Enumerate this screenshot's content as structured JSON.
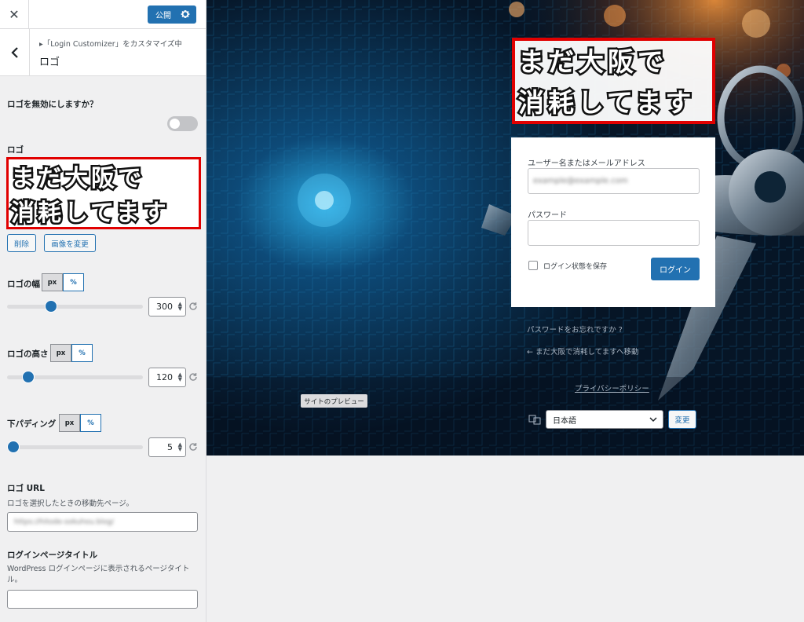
{
  "header": {
    "close_icon": "close-icon",
    "publish_label": "公開",
    "gear_icon": "gear-icon",
    "breadcrumb": "▸「Login Customizer」をカスタマイズ中",
    "section_title": "ロゴ"
  },
  "controls": {
    "disable_logo_label": "ロゴを無効にしますか？",
    "logo_label": "ロゴ",
    "logo_image_lines": [
      "まだ大阪で",
      "消耗してます"
    ],
    "remove_button": "削除",
    "change_image_button": "画像を変更",
    "logo_width": {
      "label": "ロゴの幅",
      "units": [
        "px",
        "%"
      ],
      "value": "300",
      "level": 0.3
    },
    "logo_height": {
      "label": "ロゴの高さ",
      "units": [
        "px",
        "%"
      ],
      "value": "120",
      "level": 0.15
    },
    "bottom_padding": {
      "label": "下パディング",
      "units": [
        "px",
        "%"
      ],
      "value": "5",
      "level": 0.02
    },
    "logo_url": {
      "label": "ロゴ URL",
      "description": "ロゴを選択したときの移動先ページ。",
      "value": "https://hitode-sokuhou.blog/"
    },
    "login_page_title": {
      "label": "ログインページタイトル",
      "description": "WordPress ログインページに表示されるページタイトル。",
      "value": ""
    }
  },
  "preview": {
    "logo_lines": [
      "まだ大阪で",
      "消耗してます"
    ],
    "username_label": "ユーザー名またはメールアドレス",
    "username_value": "example@example.com",
    "password_label": "パスワード",
    "remember_label": "ログイン状態を保存",
    "login_button": "ログイン",
    "lost_password": "パスワードをお忘れですか ?",
    "back_link": "← まだ大阪で消耗してますへ移動",
    "privacy_policy": "プライバシーポリシー",
    "preview_tag": "サイトのプレビュー",
    "language_selected": "日本語",
    "change_button": "変更"
  },
  "colors": {
    "accent": "#2271b1",
    "highlight_border": "#e10000"
  }
}
